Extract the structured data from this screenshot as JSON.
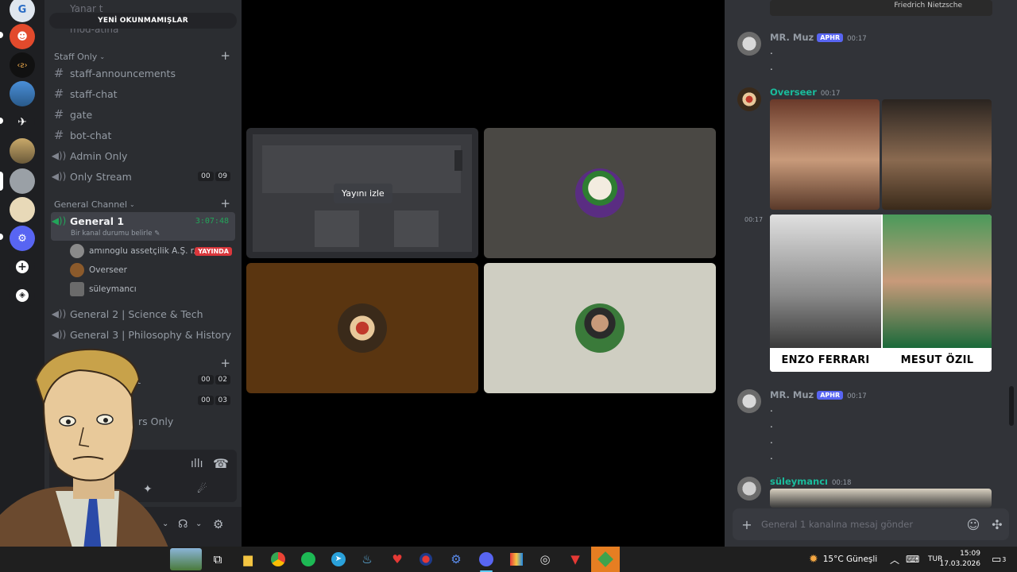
{
  "sidebar": {
    "unread_label": "YENİ OKUNMAMIŞLAR",
    "ghost_top": "Yanar t",
    "ghost_mod": "mod-atina",
    "categories": {
      "staff": "Staff Only",
      "general": "General Channel"
    },
    "staff_channels": [
      "staff-announcements",
      "staff-chat",
      "gate",
      "bot-chat",
      "Admin Only",
      "Only Stream"
    ],
    "only_stream_counts": [
      "00",
      "09"
    ],
    "general1": {
      "name": "General 1",
      "timer": "3:07:48",
      "status": "Bir kanal durumu belirle"
    },
    "voice_users": [
      {
        "name": "amınoglu assetçilik A.Ş. r...",
        "badge": "YAYINDA"
      },
      {
        "name": "Overseer"
      },
      {
        "name": "süleymancı"
      }
    ],
    "general2": "General 2 | Science & Tech",
    "general3": "General 3 | Philosophy & History",
    "partial_1": "1",
    "partial_counts_1": [
      "00",
      "02"
    ],
    "partial_counts_2": [
      "00",
      "03"
    ],
    "partial_only": "rs Only"
  },
  "stage": {
    "watch_label": "Yayını izle"
  },
  "chat": {
    "messages": [
      {
        "user": "MR. Muz",
        "tag": "APHR",
        "time": "00:17",
        "color": "#949ba4"
      },
      {
        "user": "Overseer",
        "time": "00:17",
        "color": "#1abc9c"
      },
      {
        "user": "MR. Muz",
        "tag": "APHR",
        "time": "00:17",
        "color": "#949ba4"
      },
      {
        "user": "süleymancı",
        "time": "00:18",
        "color": "#1abc9c"
      }
    ],
    "side_time": "00:17",
    "captions": [
      "ENZO FERRARI",
      "MESUT ÖZIL"
    ],
    "top_partial": "Friedrich Nietzsche",
    "composer_placeholder": "General 1 kanalına mesaj gönder"
  },
  "taskbar": {
    "weather": "15°C  Güneşli",
    "lang": "TUR",
    "time": "15:09",
    "date": "17.03.2026",
    "notif_count": "3"
  },
  "icons": [
    "twitter-icon",
    "folder-icon",
    "chrome-icon",
    "spotify-icon",
    "telegram-icon",
    "steam-icon",
    "heart-icon",
    "discord-icon",
    "settings-icon"
  ]
}
